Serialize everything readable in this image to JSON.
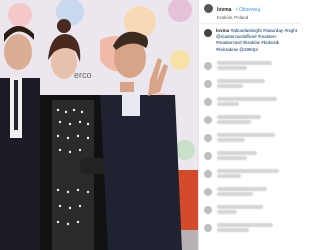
{
  "post": {
    "username": "lovma",
    "follow_label": "Obserwuj",
    "location": "Kraków, Poland",
    "caption": {
      "username": "lovma",
      "text": "#aboutlastnight #saturday #night @mastercardofficiel #masterc #mastercard #kraków #kokosik #kokrakow @1994pl"
    }
  },
  "photo": {
    "description": ""
  },
  "comments": [
    {
      "label": "blurred comment 1"
    },
    {
      "label": "blurred comment 2"
    },
    {
      "label": "blurred comment 3"
    },
    {
      "label": "blurred comment 4"
    },
    {
      "label": "blurred comment 5"
    },
    {
      "label": "blurred comment 6"
    },
    {
      "label": "blurred comment 7"
    },
    {
      "label": "blurred comment 8"
    },
    {
      "label": "blurred comment 9"
    },
    {
      "label": "blurred comment 10"
    }
  ],
  "colors": {
    "link": "#3897f0",
    "text": "#262626",
    "bg": "#ffffff"
  }
}
